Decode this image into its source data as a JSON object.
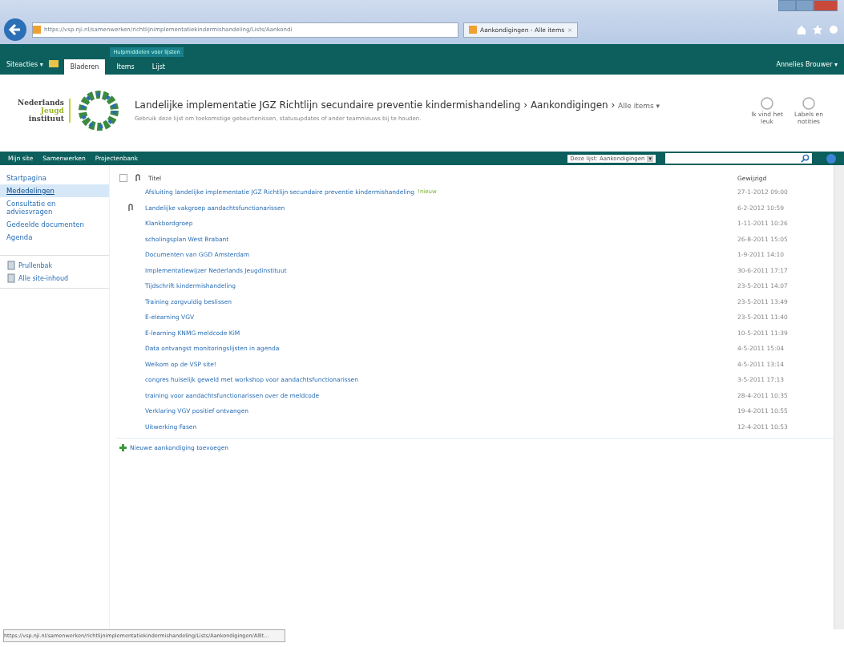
{
  "browser": {
    "address": "https://vsp.nji.nl/samenwerken/richtlijnimplementatiekindermishandeling/Lists/Aankondi",
    "tab": "Aankondigingen - Alle items",
    "tab_close": "×"
  },
  "ribbon": {
    "site_actions": "Siteacties ▾",
    "context_group": "Hulpmiddelen voor lijsten",
    "tabs": [
      {
        "label": "Bladeren",
        "selected": true
      },
      {
        "label": "Items",
        "selected": false
      },
      {
        "label": "Lijst",
        "selected": false
      }
    ],
    "user": "Annelies Brouwer ▾"
  },
  "header": {
    "logo": [
      "Nederlands",
      "Jeugd",
      "instituut"
    ],
    "site": "Landelijke implementatie JGZ Richtlijn secundaire preventie kindermishandeling",
    "sep": "›",
    "list": "Aankondigingen",
    "view": "Alle items ▾",
    "description": "Gebruik deze lijst om toekomstige gebeurtenissen, statusupdates of ander teamnieuws bij te houden.",
    "actions": [
      "Ik vind het leuk",
      "Labels en notities"
    ]
  },
  "topnav": {
    "items": [
      "Mijn site",
      "Samenwerken",
      "Projectenbank"
    ],
    "scope": "Deze lijst: Aankondigingen",
    "scope_arrow": "▾"
  },
  "sidebar": {
    "items": [
      {
        "label": "Startpagina",
        "selected": false
      },
      {
        "label": "Mededelingen",
        "selected": true
      },
      {
        "label": "Consultatie en adviesvragen",
        "selected": false
      },
      {
        "label": "Gedeelde documenten",
        "selected": false
      },
      {
        "label": "Agenda",
        "selected": false
      }
    ],
    "tools": [
      "Prullenbak",
      "Alle site-inhoud"
    ]
  },
  "table": {
    "select_all_checked": false,
    "columns": [
      "Titel",
      "Gewijzigd"
    ],
    "rows": [
      {
        "title": "Afsluiting landelijke implementatie JGZ Richtlijn secundaire preventie kindermishandeling",
        "new": "!nieuw",
        "attachment": false,
        "modified": "27-1-2012 09:00"
      },
      {
        "title": "Landelijke vakgroep aandachtsfunctionarissen",
        "attachment": true,
        "modified": "6-2-2012 10:59"
      },
      {
        "title": "Klankbordgroep",
        "attachment": false,
        "modified": "1-11-2011 10:26"
      },
      {
        "title": "scholingsplan West Brabant",
        "attachment": false,
        "modified": "26-8-2011 15:05"
      },
      {
        "title": "Documenten van GGD Amsterdam",
        "attachment": false,
        "modified": "1-9-2011 14:10"
      },
      {
        "title": "Implementatiewijzer Nederlands Jeugdinstituut",
        "attachment": false,
        "modified": "30-6-2011 17:17"
      },
      {
        "title": "Tijdschrift kindermishandeling",
        "attachment": false,
        "modified": "23-5-2011 14:07"
      },
      {
        "title": "Training zorgvuldig beslissen",
        "attachment": false,
        "modified": "23-5-2011 13:49"
      },
      {
        "title": "E-elearning VGV",
        "attachment": false,
        "modified": "23-5-2011 11:40"
      },
      {
        "title": "E-learning KNMG meldcode KiM",
        "attachment": false,
        "modified": "10-5-2011 11:39"
      },
      {
        "title": "Data ontvangst monitoringslijsten in agenda",
        "attachment": false,
        "modified": "4-5-2011 15:04"
      },
      {
        "title": "Welkom op de VSP site!",
        "attachment": false,
        "modified": "4-5-2011 13:14"
      },
      {
        "title": "congres huiselijk geweld met workshop voor aandachtsfunctionarissen",
        "attachment": false,
        "modified": "3-5-2011 17:13"
      },
      {
        "title": "training voor aandachtsfunctionarissen over de meldcode",
        "attachment": false,
        "modified": "28-4-2011 10:35"
      },
      {
        "title": "Verklaring VGV positief ontvangen",
        "attachment": false,
        "modified": "19-4-2011 10:55"
      },
      {
        "title": "Uitwerking Fasen",
        "attachment": false,
        "modified": "12-4-2011 10:53"
      }
    ],
    "add": "Nieuwe aankondiging toevoegen"
  },
  "status_bar": "https://vsp.nji.nl/samenwerken/richtlijnimplementatiekindermishandeling/Lists/Aankondigingen/AllIt..."
}
